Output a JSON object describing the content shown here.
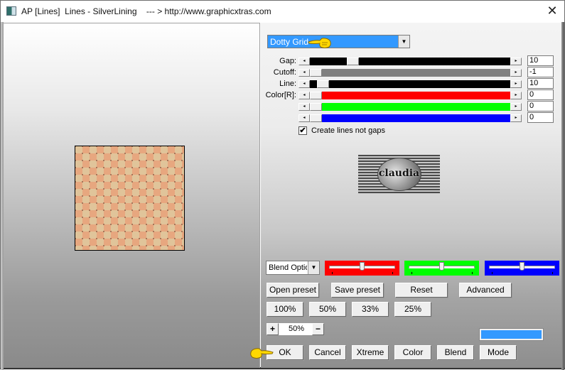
{
  "window": {
    "title": "AP [Lines]  Lines - SilverLining    --- > http://www.graphicxtras.com",
    "close_icon": "close-x-icon"
  },
  "preview": {
    "description": "Dotty grid checker pattern preview",
    "colors": {
      "light": "#e0c49a",
      "dark": "#e7a77f",
      "dot": "#9a6a50"
    }
  },
  "effect": {
    "selected": "Dotty Grid",
    "selection_color": "#3399ff"
  },
  "sliders": [
    {
      "label": "Gap:",
      "value": "10",
      "track_color": "#000000",
      "position": 0.24
    },
    {
      "label": "Cutoff:",
      "value": "-1",
      "track_color": "#808080",
      "position": 0.0
    },
    {
      "label": "Line:",
      "value": "10",
      "track_color": "#000000",
      "position": 0.04,
      "left_track_color": "#000000"
    },
    {
      "label": "Color[R]:",
      "value": "0",
      "track_color": "#ff0000",
      "position": 0.0
    },
    {
      "label": "",
      "value": "0",
      "track_color": "#00ff00",
      "position": 0.0
    },
    {
      "label": "",
      "value": "0",
      "track_color": "#0000ff",
      "position": 0.0
    }
  ],
  "checkbox": {
    "label": "Create lines not gaps",
    "checked": true,
    "mark": "✔"
  },
  "logo": {
    "text": "claudia"
  },
  "blend": {
    "selected": "Blend Options",
    "color_sliders": [
      {
        "name": "red",
        "color": "#ff0000",
        "position": 0.5
      },
      {
        "name": "green",
        "color": "#00ff00",
        "position": 0.5
      },
      {
        "name": "blue",
        "color": "#0000ff",
        "position": 0.5
      }
    ]
  },
  "preset_buttons": [
    "Open preset",
    "Save preset",
    "Reset",
    "Advanced"
  ],
  "zoom_buttons": [
    "100%",
    "50%",
    "33%",
    "25%"
  ],
  "zoom": {
    "plus": "+",
    "value": "50%",
    "minus": "−"
  },
  "swatch_color": "#3399ff",
  "bottom_buttons": [
    "OK",
    "Cancel",
    "Xtreme",
    "Color",
    "Blend",
    "Mode"
  ]
}
